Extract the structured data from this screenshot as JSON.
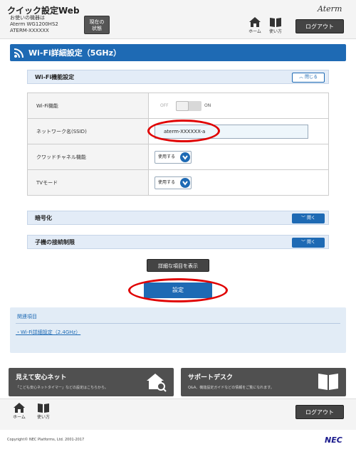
{
  "header": {
    "app_title": "クイック設定Web",
    "device_line1": "お使いの機器は",
    "device_line2": "Aterm WG1200HS2",
    "device_line3": "ATERM-XXXXXX",
    "status_button_line1": "現在の",
    "status_button_line2": "状態",
    "brand": "Aterm",
    "home_label": "ホーム",
    "help_label": "使い方",
    "logout_label": "ログアウト"
  },
  "page": {
    "title": "Wi-Fi詳細設定（5GHz）"
  },
  "section_wifi": {
    "label": "Wi-Fi機能設定",
    "toggle_label": "閉じる"
  },
  "settings": {
    "wifi_function": {
      "label": "Wi-Fi機能",
      "off_label": "OFF",
      "on_label": "ON"
    },
    "ssid": {
      "label": "ネットワーク名(SSID)",
      "value": "aterm-XXXXXX-a"
    },
    "quad_channel": {
      "label": "クワッドチャネル機能",
      "value": "使用する"
    },
    "tv_mode": {
      "label": "TVモード",
      "value": "使用する"
    }
  },
  "section_encryption": {
    "label": "暗号化",
    "toggle_label": "開く"
  },
  "section_restriction": {
    "label": "子機の接続制限",
    "toggle_label": "開く"
  },
  "actions": {
    "detail_button": "詳細な項目を表示",
    "apply_button": "設定"
  },
  "related": {
    "title": "関連項目",
    "link": "Wi-Fi詳細設定（2.4GHz）"
  },
  "promos": {
    "left_title": "見えて安心ネット",
    "left_sub": "「こども安心ネットタイマー」などの設定はこちらから。",
    "right_title": "サポートデスク",
    "right_sub": "Q&A、機能設定ガイドなどの情報をご覧になれます。"
  },
  "footer": {
    "home_label": "ホーム",
    "help_label": "使い方",
    "logout_label": "ログアウト",
    "copyright": "Copyright© NEC Platforms, Ltd. 2001-2017",
    "logo": "NEC"
  },
  "colors": {
    "accent": "#1e6ab4",
    "annotation": "#e00000"
  }
}
